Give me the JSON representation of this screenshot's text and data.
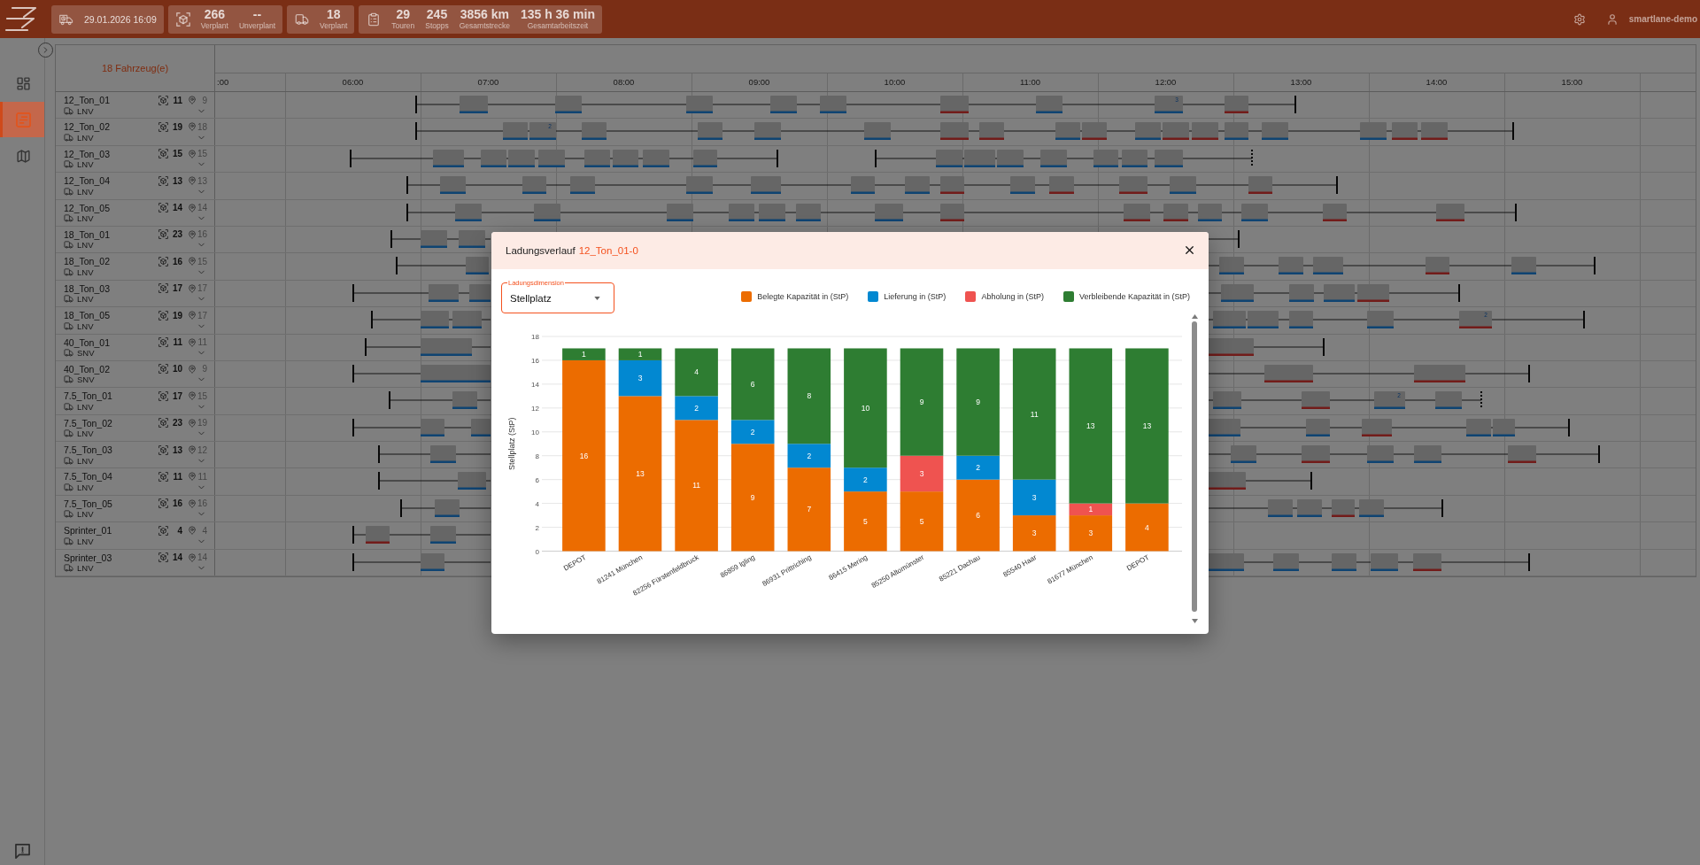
{
  "top_bar": {
    "stat_cards": [
      {
        "kind": "datetime",
        "stats": [
          {
            "value": "29.01.2026 16:09"
          }
        ]
      },
      {
        "kind": "shipments",
        "stats": [
          {
            "value": "266",
            "label": "Verplant"
          },
          {
            "value": "--",
            "label": "Unverplant"
          }
        ]
      },
      {
        "kind": "vehicles",
        "stats": [
          {
            "value": "18",
            "label": "Verplant"
          }
        ]
      },
      {
        "kind": "tours",
        "stats": [
          {
            "value": "29",
            "label": "Touren"
          },
          {
            "value": "245",
            "label": "Stopps"
          },
          {
            "value": "3856 km",
            "label": "Gesamtstrecke"
          },
          {
            "value": "135 h 36 min",
            "label": "Gesamtarbeitszeit"
          }
        ]
      }
    ],
    "user": "smartlane-demo"
  },
  "sidebar": {
    "items": [
      {
        "kind": "dashboard",
        "selected": false
      },
      {
        "kind": "planning",
        "selected": true
      },
      {
        "kind": "map",
        "selected": false
      }
    ]
  },
  "schedule": {
    "vehicle_count": "18 Fahrzeug(e)",
    "hours": [
      ":00",
      "06:00",
      "07:00",
      "08:00",
      "09:00",
      "10:00",
      "11:00",
      "12:00",
      "13:00",
      "14:00",
      "15:00"
    ],
    "vehicles": [
      {
        "name": "12_Ton_01",
        "type": "LNV",
        "shipments": "11",
        "stop_count": "9",
        "stops": [
          {
            "kind": "delivery"
          },
          {
            "kind": "delivery"
          },
          {
            "kind": "delivery"
          },
          {
            "kind": "delivery"
          },
          {
            "kind": "delivery"
          },
          {
            "kind": "pickup"
          },
          {
            "kind": "delivery"
          },
          {
            "kind": "delivery",
            "label": "3"
          },
          {
            "kind": "pickup"
          }
        ]
      },
      {
        "name": "12_Ton_02",
        "type": "LNV",
        "shipments": "19",
        "stop_count": "18",
        "stops": [
          {
            "kind": "delivery"
          },
          {
            "kind": "delivery",
            "label": "2"
          },
          {
            "kind": "delivery"
          },
          {
            "kind": "delivery"
          },
          {
            "kind": "delivery"
          },
          {
            "kind": "delivery"
          },
          {
            "kind": "pickup"
          },
          {
            "kind": "pickup"
          },
          {
            "kind": "delivery"
          },
          {
            "kind": "pickup"
          },
          {
            "kind": "delivery"
          },
          {
            "kind": "pickup"
          },
          {
            "kind": "pickup"
          },
          {
            "kind": "delivery"
          },
          {
            "kind": "delivery"
          },
          {
            "kind": "delivery"
          },
          {
            "kind": "pickup"
          },
          {
            "kind": "pickup"
          }
        ]
      },
      {
        "name": "12_Ton_03",
        "type": "LNV",
        "shipments": "15",
        "stop_count": "15",
        "stops": [
          {
            "kind": "delivery"
          },
          {
            "kind": "delivery"
          },
          {
            "kind": "delivery"
          },
          {
            "kind": "delivery"
          },
          {
            "kind": "delivery"
          },
          {
            "kind": "delivery"
          },
          {
            "kind": "delivery"
          },
          {
            "kind": "delivery"
          },
          {
            "kind": "delivery"
          },
          {
            "kind": "delivery"
          },
          {
            "kind": "delivery"
          },
          {
            "kind": "delivery"
          },
          {
            "kind": "delivery"
          },
          {
            "kind": "delivery"
          },
          {
            "kind": "delivery"
          }
        ]
      },
      {
        "name": "12_Ton_04",
        "type": "LNV",
        "shipments": "13",
        "stop_count": "13",
        "stops": [
          {
            "kind": "delivery"
          },
          {
            "kind": "delivery"
          },
          {
            "kind": "delivery"
          },
          {
            "kind": "delivery"
          },
          {
            "kind": "delivery"
          },
          {
            "kind": "delivery"
          },
          {
            "kind": "delivery"
          },
          {
            "kind": "pickup"
          },
          {
            "kind": "delivery"
          },
          {
            "kind": "pickup"
          },
          {
            "kind": "pickup"
          },
          {
            "kind": "delivery"
          },
          {
            "kind": "pickup"
          }
        ]
      },
      {
        "name": "12_Ton_05",
        "type": "LNV",
        "shipments": "14",
        "stop_count": "14",
        "stops": [
          {
            "kind": "delivery"
          },
          {
            "kind": "delivery"
          },
          {
            "kind": "delivery"
          },
          {
            "kind": "delivery"
          },
          {
            "kind": "delivery"
          },
          {
            "kind": "delivery"
          },
          {
            "kind": "delivery"
          },
          {
            "kind": "pickup"
          },
          {
            "kind": "pickup"
          },
          {
            "kind": "pickup"
          },
          {
            "kind": "delivery"
          },
          {
            "kind": "delivery"
          },
          {
            "kind": "pickup"
          },
          {
            "kind": "pickup"
          }
        ]
      },
      {
        "name": "18_Ton_01",
        "type": "LNV",
        "shipments": "23",
        "stop_count": "16",
        "stops": [
          {
            "kind": "delivery"
          },
          {
            "kind": "delivery"
          }
        ]
      },
      {
        "name": "18_Ton_02",
        "type": "LNV",
        "shipments": "16",
        "stop_count": "15",
        "stops": [
          {
            "kind": "delivery"
          },
          {
            "kind": "delivery"
          },
          {
            "kind": "delivery"
          },
          {
            "kind": "delivery"
          },
          {
            "kind": "pickup"
          },
          {
            "kind": "delivery"
          }
        ]
      },
      {
        "name": "18_Ton_03",
        "type": "LNV",
        "shipments": "17",
        "stop_count": "17",
        "stops": [
          {
            "kind": "delivery"
          },
          {
            "kind": "delivery"
          },
          {
            "kind": "delivery"
          },
          {
            "kind": "delivery"
          },
          {
            "kind": "delivery"
          },
          {
            "kind": "pickup"
          }
        ]
      },
      {
        "name": "18_Ton_05",
        "type": "LNV",
        "shipments": "19",
        "stop_count": "17",
        "stops": [
          {
            "kind": "delivery"
          },
          {
            "kind": "delivery"
          },
          {
            "kind": "delivery"
          },
          {
            "kind": "delivery"
          },
          {
            "kind": "delivery"
          },
          {
            "kind": "delivery"
          },
          {
            "kind": "pickup",
            "label": "2"
          }
        ]
      },
      {
        "name": "40_Ton_01",
        "type": "SNV",
        "shipments": "11",
        "stop_count": "11",
        "stops": [
          {
            "kind": "delivery"
          },
          {
            "kind": "pickup"
          }
        ]
      },
      {
        "name": "40_Ton_02",
        "type": "SNV",
        "shipments": "10",
        "stop_count": "9",
        "stops": [
          {
            "kind": "delivery"
          },
          {
            "kind": "pickup"
          },
          {
            "kind": "pickup"
          }
        ]
      },
      {
        "name": "7.5_Ton_01",
        "type": "LNV",
        "shipments": "17",
        "stop_count": "15",
        "stops": [
          {
            "kind": "delivery"
          },
          {
            "kind": "delivery"
          },
          {
            "kind": "pickup"
          },
          {
            "kind": "delivery",
            "label": "2"
          },
          {
            "kind": "delivery"
          }
        ]
      },
      {
        "name": "7.5_Ton_02",
        "type": "LNV",
        "shipments": "23",
        "stop_count": "19",
        "stops": [
          {
            "kind": "delivery"
          },
          {
            "kind": "delivery"
          },
          {
            "kind": "delivery"
          },
          {
            "kind": "delivery"
          },
          {
            "kind": "pickup"
          },
          {
            "kind": "delivery"
          },
          {
            "kind": "delivery"
          }
        ]
      },
      {
        "name": "7.5_Ton_03",
        "type": "LNV",
        "shipments": "13",
        "stop_count": "12",
        "stops": [
          {
            "kind": "delivery"
          },
          {
            "kind": "delivery"
          },
          {
            "kind": "pickup"
          },
          {
            "kind": "delivery"
          },
          {
            "kind": "delivery"
          },
          {
            "kind": "pickup"
          }
        ]
      },
      {
        "name": "7.5_Ton_04",
        "type": "LNV",
        "shipments": "11",
        "stop_count": "11",
        "stops": [
          {
            "kind": "delivery"
          },
          {
            "kind": "pickup"
          }
        ]
      },
      {
        "name": "7.5_Ton_05",
        "type": "LNV",
        "shipments": "16",
        "stop_count": "16",
        "stops": [
          {
            "kind": "delivery"
          },
          {
            "kind": "delivery"
          },
          {
            "kind": "delivery"
          },
          {
            "kind": "pickup"
          },
          {
            "kind": "delivery"
          }
        ]
      },
      {
        "name": "Sprinter_01",
        "type": "LNV",
        "shipments": "4",
        "stop_count": "4",
        "stops": [
          {
            "kind": "pickup"
          },
          {
            "kind": "delivery"
          }
        ]
      },
      {
        "name": "Sprinter_03",
        "type": "LNV",
        "shipments": "14",
        "stop_count": "14",
        "stops": [
          {
            "kind": "delivery"
          },
          {
            "kind": "delivery"
          },
          {
            "kind": "delivery"
          },
          {
            "kind": "delivery"
          },
          {
            "kind": "delivery"
          },
          {
            "kind": "pickup"
          }
        ]
      }
    ]
  },
  "dialog": {
    "title": "Ladungsverlauf",
    "tour": "12_Ton_01-0",
    "dimension_select": {
      "label": "Ladungsdimension",
      "value": "Stellplatz"
    },
    "chart_data": {
      "type": "bar",
      "ylabel": "Stellplatz (StP)",
      "categories": [
        "DEPOT",
        "81241 München",
        "82256 Fürstenfeldbruck",
        "86859 Igling",
        "86931 Prittriching",
        "86415 Mering",
        "85250 Altomünster",
        "85221 Dachau",
        "85540 Haar",
        "81677 München",
        "DEPOT"
      ],
      "series": [
        {
          "name": "Belegte Kapazität in (StP)",
          "color": "#ec6c00",
          "values": [
            16,
            13,
            11,
            9,
            7,
            5,
            5,
            6,
            3,
            3,
            4
          ]
        },
        {
          "name": "Lieferung in (StP)",
          "color": "#0288d1",
          "values": [
            null,
            3,
            2,
            2,
            2,
            2,
            null,
            2,
            3,
            null,
            null
          ]
        },
        {
          "name": "Abholung in (StP)",
          "color": "#ef5350",
          "values": [
            null,
            null,
            null,
            null,
            null,
            null,
            3,
            null,
            null,
            1,
            null
          ]
        },
        {
          "name": "Verbleibende Kapazität in (StP)",
          "color": "#2e7d32",
          "values": [
            1,
            1,
            4,
            6,
            8,
            10,
            9,
            9,
            11,
            13,
            13
          ]
        }
      ],
      "ylim": [
        0,
        18
      ],
      "yticks": [
        0,
        2,
        4,
        6,
        8,
        10,
        12,
        14,
        16,
        18
      ],
      "stacked": true,
      "data_labels": true,
      "grid": true,
      "legend": true
    }
  }
}
